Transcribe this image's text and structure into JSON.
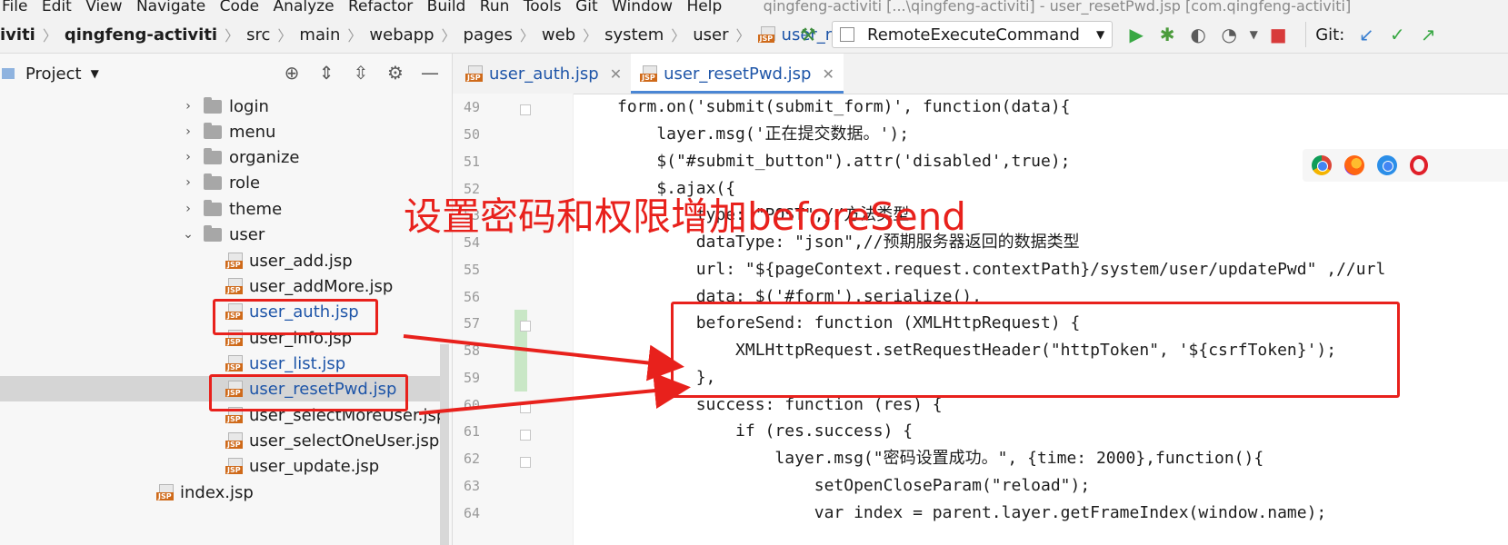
{
  "menu": {
    "items": [
      "File",
      "Edit",
      "View",
      "Navigate",
      "Code",
      "Analyze",
      "Refactor",
      "Build",
      "Run",
      "Tools",
      "Git",
      "Window",
      "Help"
    ],
    "window_title": "qingfeng-activiti [...\\qingfeng-activiti] - user_resetPwd.jsp [com.qingfeng-activiti]"
  },
  "breadcrumb": [
    "iviti",
    "qingfeng-activiti",
    "src",
    "main",
    "webapp",
    "pages",
    "web",
    "system",
    "user",
    "user_resetPwd.jsp"
  ],
  "toolbar": {
    "run_config": "RemoteExecuteCommand",
    "git_label": "Git:"
  },
  "project": {
    "title": "Project",
    "tree": [
      {
        "label": "login",
        "type": "folder",
        "depth": 1
      },
      {
        "label": "menu",
        "type": "folder",
        "depth": 1
      },
      {
        "label": "organize",
        "type": "folder",
        "depth": 1
      },
      {
        "label": "role",
        "type": "folder",
        "depth": 1
      },
      {
        "label": "theme",
        "type": "folder",
        "depth": 1
      },
      {
        "label": "user",
        "type": "folder",
        "depth": 1,
        "expanded": true
      },
      {
        "label": "user_add.jsp",
        "type": "jsp",
        "depth": 2
      },
      {
        "label": "user_addMore.jsp",
        "type": "jsp",
        "depth": 2
      },
      {
        "label": "user_auth.jsp",
        "type": "jsp",
        "depth": 2,
        "modified": true
      },
      {
        "label": "user_info.jsp",
        "type": "jsp",
        "depth": 2
      },
      {
        "label": "user_list.jsp",
        "type": "jsp",
        "depth": 2,
        "modified": true
      },
      {
        "label": "user_resetPwd.jsp",
        "type": "jsp",
        "depth": 2,
        "modified": true,
        "selected": true
      },
      {
        "label": "user_selectMoreUser.jsp",
        "type": "jsp",
        "depth": 2
      },
      {
        "label": "user_selectOneUser.jsp",
        "type": "jsp",
        "depth": 2
      },
      {
        "label": "user_update.jsp",
        "type": "jsp",
        "depth": 2
      },
      {
        "label": "index.jsp",
        "type": "jsp",
        "depth": 0
      }
    ]
  },
  "tabs": [
    {
      "label": "user_auth.jsp",
      "active": false
    },
    {
      "label": "user_resetPwd.jsp",
      "active": true
    }
  ],
  "editor": {
    "line_numbers": [
      "49",
      "50",
      "51",
      "52",
      "53",
      "54",
      "55",
      "56",
      "57",
      "58",
      "59",
      "60",
      "61",
      "62",
      "63",
      "64"
    ],
    "code_lines": [
      "form.on('submit(submit_form)', function(data){",
      "    layer.msg('正在提交数据。');",
      "    $(\"#submit_button\").attr('disabled',true);",
      "    $.ajax({",
      "        type: \"POST\",//方法类型",
      "        dataType: \"json\",//预期服务器返回的数据类型",
      "        url: \"${pageContext.request.contextPath}/system/user/updatePwd\" ,//url",
      "        data: $('#form').serialize(),",
      "        beforeSend: function (XMLHttpRequest) {",
      "            XMLHttpRequest.setRequestHeader(\"httpToken\", '${csrfToken}');",
      "        },",
      "        success: function (res) {",
      "            if (res.success) {",
      "                layer.msg(\"密码设置成功。\", {time: 2000},function(){",
      "                    setOpenCloseParam(\"reload\");",
      "                    var index = parent.layer.getFrameIndex(window.name);"
    ]
  },
  "annotation": {
    "text": "设置密码和权限增加beforeSend",
    "color": "#e8211c"
  },
  "icons": [
    "hammer-icon",
    "run-icon",
    "debug-icon",
    "coverage-icon",
    "profile-icon",
    "stop-icon",
    "git-update-icon",
    "git-commit-icon",
    "git-push-icon",
    "chrome-icon",
    "firefox-icon",
    "safari-icon",
    "opera-icon"
  ]
}
